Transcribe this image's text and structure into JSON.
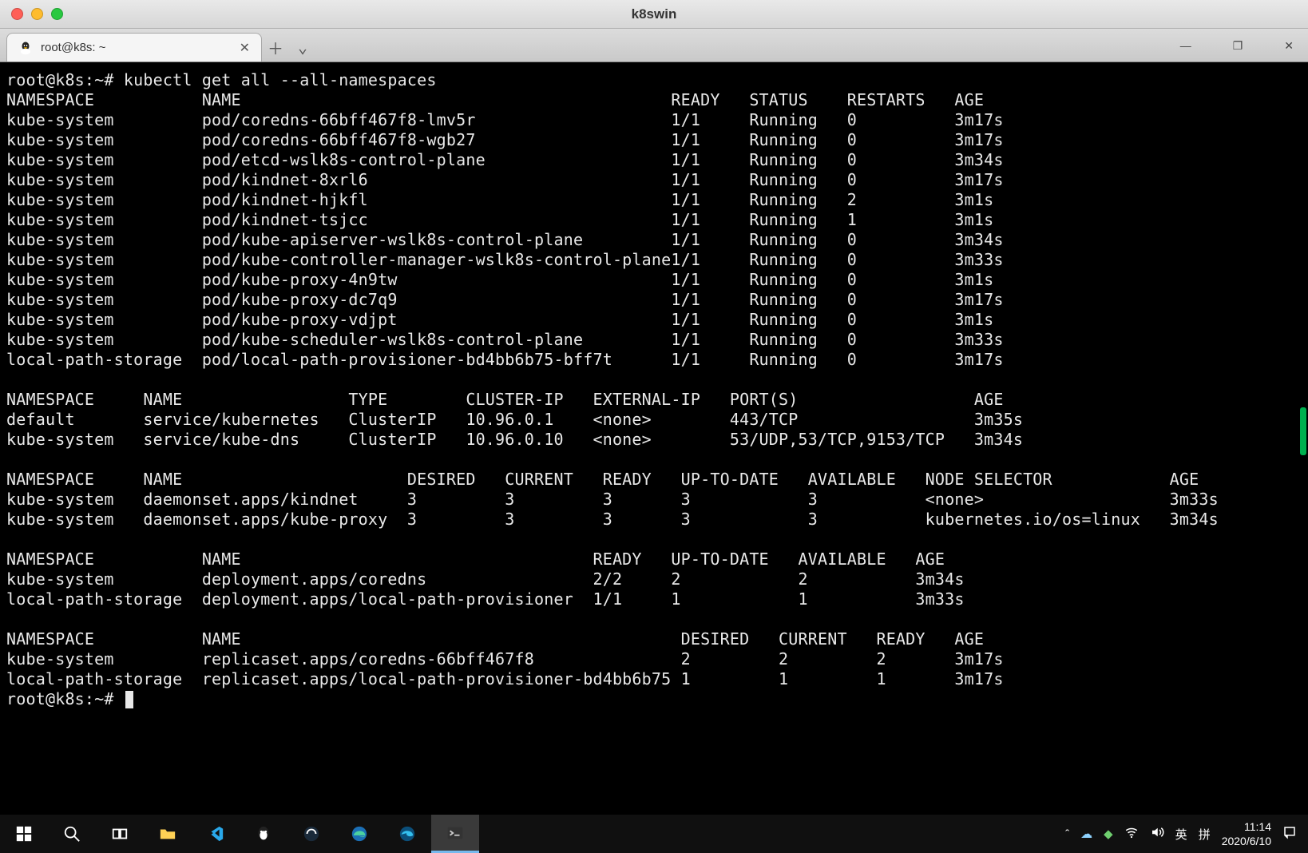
{
  "window": {
    "title": "k8swin"
  },
  "tab": {
    "label": "root@k8s: ~"
  },
  "terminal": {
    "prompt1": "root@k8s:~# ",
    "command1": "kubectl get all --all-namespaces",
    "pods_header": {
      "c0": "NAMESPACE",
      "c1": "NAME",
      "c2": "READY",
      "c3": "STATUS",
      "c4": "RESTARTS",
      "c5": "AGE"
    },
    "pods": [
      {
        "ns": "kube-system",
        "name": "pod/coredns-66bff467f8-lmv5r",
        "ready": "1/1",
        "status": "Running",
        "restarts": "0",
        "age": "3m17s"
      },
      {
        "ns": "kube-system",
        "name": "pod/coredns-66bff467f8-wgb27",
        "ready": "1/1",
        "status": "Running",
        "restarts": "0",
        "age": "3m17s"
      },
      {
        "ns": "kube-system",
        "name": "pod/etcd-wslk8s-control-plane",
        "ready": "1/1",
        "status": "Running",
        "restarts": "0",
        "age": "3m34s"
      },
      {
        "ns": "kube-system",
        "name": "pod/kindnet-8xrl6",
        "ready": "1/1",
        "status": "Running",
        "restarts": "0",
        "age": "3m17s"
      },
      {
        "ns": "kube-system",
        "name": "pod/kindnet-hjkfl",
        "ready": "1/1",
        "status": "Running",
        "restarts": "2",
        "age": "3m1s"
      },
      {
        "ns": "kube-system",
        "name": "pod/kindnet-tsjcc",
        "ready": "1/1",
        "status": "Running",
        "restarts": "1",
        "age": "3m1s"
      },
      {
        "ns": "kube-system",
        "name": "pod/kube-apiserver-wslk8s-control-plane",
        "ready": "1/1",
        "status": "Running",
        "restarts": "0",
        "age": "3m34s"
      },
      {
        "ns": "kube-system",
        "name": "pod/kube-controller-manager-wslk8s-control-plane",
        "ready": "1/1",
        "status": "Running",
        "restarts": "0",
        "age": "3m33s"
      },
      {
        "ns": "kube-system",
        "name": "pod/kube-proxy-4n9tw",
        "ready": "1/1",
        "status": "Running",
        "restarts": "0",
        "age": "3m1s"
      },
      {
        "ns": "kube-system",
        "name": "pod/kube-proxy-dc7q9",
        "ready": "1/1",
        "status": "Running",
        "restarts": "0",
        "age": "3m17s"
      },
      {
        "ns": "kube-system",
        "name": "pod/kube-proxy-vdjpt",
        "ready": "1/1",
        "status": "Running",
        "restarts": "0",
        "age": "3m1s"
      },
      {
        "ns": "kube-system",
        "name": "pod/kube-scheduler-wslk8s-control-plane",
        "ready": "1/1",
        "status": "Running",
        "restarts": "0",
        "age": "3m33s"
      },
      {
        "ns": "local-path-storage",
        "name": "pod/local-path-provisioner-bd4bb6b75-bff7t",
        "ready": "1/1",
        "status": "Running",
        "restarts": "0",
        "age": "3m17s"
      }
    ],
    "svc_header": {
      "c0": "NAMESPACE",
      "c1": "NAME",
      "c2": "TYPE",
      "c3": "CLUSTER-IP",
      "c4": "EXTERNAL-IP",
      "c5": "PORT(S)",
      "c6": "AGE"
    },
    "svcs": [
      {
        "ns": "default",
        "name": "service/kubernetes",
        "type": "ClusterIP",
        "cip": "10.96.0.1",
        "eip": "<none>",
        "ports": "443/TCP",
        "age": "3m35s"
      },
      {
        "ns": "kube-system",
        "name": "service/kube-dns",
        "type": "ClusterIP",
        "cip": "10.96.0.10",
        "eip": "<none>",
        "ports": "53/UDP,53/TCP,9153/TCP",
        "age": "3m34s"
      }
    ],
    "ds_header": {
      "c0": "NAMESPACE",
      "c1": "NAME",
      "c2": "DESIRED",
      "c3": "CURRENT",
      "c4": "READY",
      "c5": "UP-TO-DATE",
      "c6": "AVAILABLE",
      "c7": "NODE SELECTOR",
      "c8": "AGE"
    },
    "dss": [
      {
        "ns": "kube-system",
        "name": "daemonset.apps/kindnet",
        "d": "3",
        "c": "3",
        "r": "3",
        "u": "3",
        "a": "3",
        "sel": "<none>",
        "age": "3m33s"
      },
      {
        "ns": "kube-system",
        "name": "daemonset.apps/kube-proxy",
        "d": "3",
        "c": "3",
        "r": "3",
        "u": "3",
        "a": "3",
        "sel": "kubernetes.io/os=linux",
        "age": "3m34s"
      }
    ],
    "dep_header": {
      "c0": "NAMESPACE",
      "c1": "NAME",
      "c2": "READY",
      "c3": "UP-TO-DATE",
      "c4": "AVAILABLE",
      "c5": "AGE"
    },
    "deps": [
      {
        "ns": "kube-system",
        "name": "deployment.apps/coredns",
        "ready": "2/2",
        "u": "2",
        "a": "2",
        "age": "3m34s"
      },
      {
        "ns": "local-path-storage",
        "name": "deployment.apps/local-path-provisioner",
        "ready": "1/1",
        "u": "1",
        "a": "1",
        "age": "3m33s"
      }
    ],
    "rs_header": {
      "c0": "NAMESPACE",
      "c1": "NAME",
      "c2": "DESIRED",
      "c3": "CURRENT",
      "c4": "READY",
      "c5": "AGE"
    },
    "rss": [
      {
        "ns": "kube-system",
        "name": "replicaset.apps/coredns-66bff467f8",
        "d": "2",
        "c": "2",
        "r": "2",
        "age": "3m17s"
      },
      {
        "ns": "local-path-storage",
        "name": "replicaset.apps/local-path-provisioner-bd4bb6b75",
        "d": "1",
        "c": "1",
        "r": "1",
        "age": "3m17s"
      }
    ],
    "prompt2": "root@k8s:~# "
  },
  "tray": {
    "ime1": "英",
    "ime2": "拼",
    "time": "11:14",
    "date": "2020/6/10"
  }
}
